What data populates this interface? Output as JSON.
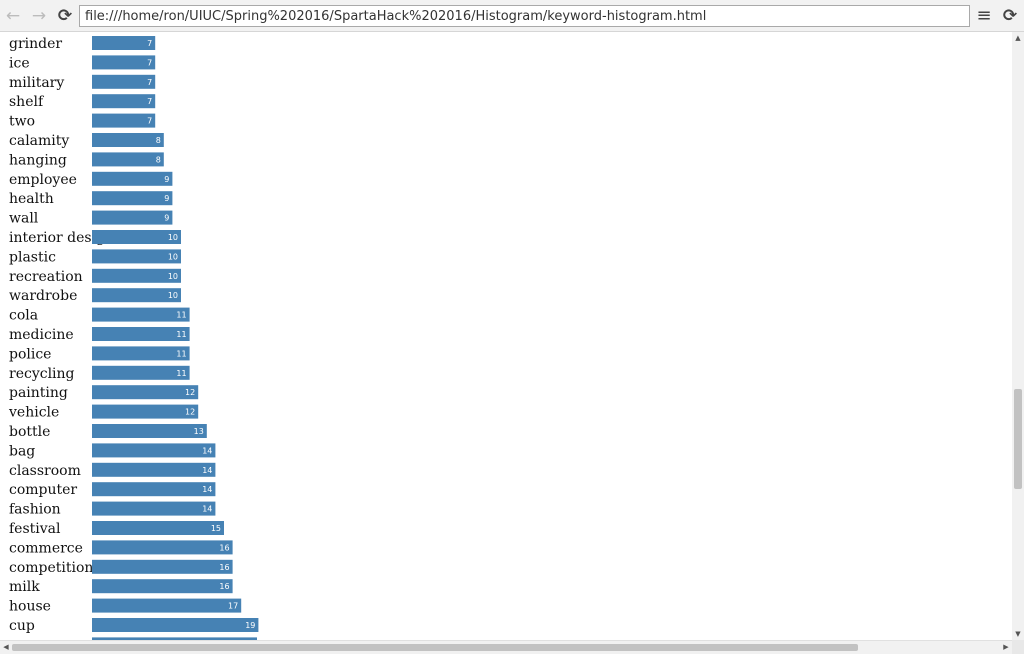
{
  "browser": {
    "url": "file:///home/ron/UIUC/Spring%202016/SpartaHack%202016/Histogram/keyword-histogram.html",
    "back_icon": "←",
    "forward_icon": "→",
    "reload_icon": "⟳",
    "menu_icon": "≡"
  },
  "chart_data": {
    "type": "bar",
    "orientation": "horizontal",
    "title": "",
    "xlabel": "",
    "ylabel": "",
    "bar_color": "#4682b4",
    "categories": [
      "grinder",
      "ice",
      "military",
      "shelf",
      "two",
      "calamity",
      "hanging",
      "employee",
      "health",
      "wall",
      "interior design",
      "plastic",
      "recreation",
      "wardrobe",
      "cola",
      "medicine",
      "police",
      "recycling",
      "painting",
      "vehicle",
      "bottle",
      "bag",
      "classroom",
      "computer",
      "fashion",
      "festival",
      "commerce",
      "competition",
      "milk",
      "house",
      "cup"
    ],
    "values": [
      7,
      7,
      7,
      7,
      7,
      8,
      8,
      9,
      9,
      9,
      10,
      10,
      10,
      10,
      11,
      11,
      11,
      11,
      12,
      12,
      13,
      14,
      14,
      14,
      14,
      15,
      16,
      16,
      16,
      17,
      19
    ]
  }
}
